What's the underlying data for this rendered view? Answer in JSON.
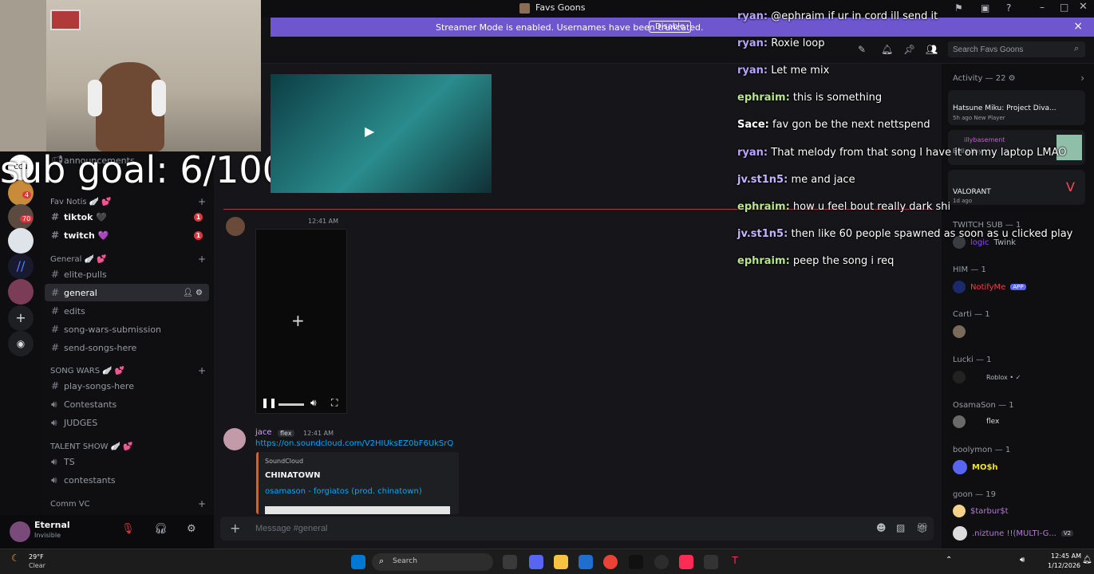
{
  "window": {
    "title": "Favs Goons"
  },
  "banner": {
    "message": "Streamer Mode is enabled. Usernames have been truncated.",
    "disable_label": "Disable",
    "close_icon": "×"
  },
  "stream": {
    "sub_goal": "sub goal: 6/100"
  },
  "toolbar": {
    "search_placeholder": "Search Favs Goons"
  },
  "sidebar": {
    "top_channel": "announcements",
    "categories": [
      {
        "name": "Fav Notis 🪽 💕",
        "channels": [
          {
            "name": "tiktok 🖤",
            "badge": "1"
          },
          {
            "name": "twitch 💜",
            "badge": "1"
          }
        ]
      },
      {
        "name": "General 🪽 💕",
        "channels": [
          {
            "name": "elite-pulls"
          },
          {
            "name": "general"
          },
          {
            "name": "edits"
          },
          {
            "name": "song-wars-submission"
          },
          {
            "name": "send-songs-here"
          }
        ]
      },
      {
        "name": "SONG WARS 🪽 💕",
        "channels": [
          {
            "name": "play-songs-here"
          },
          {
            "name": "Contestants"
          },
          {
            "name": "JUDGES"
          }
        ]
      },
      {
        "name": "TALENT SHOW 🪽 💕",
        "channels": [
          {
            "name": "TS"
          },
          {
            "name": "contestants"
          }
        ]
      },
      {
        "name": "Comm VC"
      }
    ],
    "rail_badges": [
      "4",
      "70"
    ]
  },
  "user": {
    "name": "Eternal",
    "status": "Invisible"
  },
  "messages": {
    "video_time": "12:41 AM",
    "jace": {
      "name": "jace",
      "tag": "flex",
      "time": "12:41 AM",
      "link": "https://on.soundcloud.com/V2HIUksEZ0bF6UkSrQ",
      "embed_provider": "SoundCloud",
      "embed_title": "CHINATOWN",
      "embed_track": "osamason - forgiatos (prod. chinatown)"
    }
  },
  "composer": {
    "placeholder": "Message #general"
  },
  "overlay_chat": [
    {
      "user": "ryan:",
      "text": "@ephraim if ur in cord ill send it",
      "color": "#b9a3ff"
    },
    {
      "user": "ryan:",
      "text": "Roxie loop",
      "color": "#b9a3ff"
    },
    {
      "user": "ryan:",
      "text": "Let me mix",
      "color": "#b9a3ff"
    },
    {
      "user": "ephraim:",
      "text": "this is something",
      "color": "#b7e48d"
    },
    {
      "user": "Sace:",
      "text": "fav gon be the next nettspend",
      "color": "#ffffff"
    },
    {
      "user": "ryan:",
      "text": "That melody from that song I have it on my laptop LMAO",
      "color": "#b9a3ff"
    },
    {
      "user": "jv.st1n5:",
      "text": "me and jace",
      "color": "#c7b4ff"
    },
    {
      "user": "ephraim:",
      "text": "how u feel bout really dark shi",
      "color": "#b7e48d"
    },
    {
      "user": "jv.st1n5:",
      "text": "then like 60 people spawned as soon as u clicked play",
      "color": "#c7b4ff"
    },
    {
      "user": "ephraim:",
      "text": "peep the song i req",
      "color": "#b7e48d"
    }
  ],
  "members": {
    "activity": "Activity — 22 ⚙",
    "activity_cards": [
      {
        "title": "Hatsune Miku: Project Diva...",
        "meta": "5h ago  New Player"
      },
      {
        "title": "illybasement",
        "meta": "Bella Kay"
      },
      {
        "title": "VALORANT",
        "meta": "1d ago"
      }
    ],
    "groups": [
      {
        "header": "TWITCH SUB — 1",
        "rows": [
          {
            "name": "logic",
            "extra": "Twink"
          }
        ]
      },
      {
        "header": "HIM — 1",
        "rows": [
          {
            "name": "NotifyMe",
            "extra": "APP",
            "color": "#f23f43"
          }
        ]
      },
      {
        "header": "Carti — 1",
        "rows": [
          {
            "name": ""
          }
        ]
      },
      {
        "header": "Lucki — 1",
        "rows": [
          {
            "name": "Roblox • ✓",
            "extra": ""
          }
        ]
      },
      {
        "header": "OsamaSon — 1",
        "rows": [
          {
            "name": "flex"
          }
        ]
      },
      {
        "header": "boolymon — 1",
        "rows": [
          {
            "name": "MO$h",
            "color": "#f0e130"
          }
        ]
      },
      {
        "header": "goon — 19",
        "rows": [
          {
            "name": "$tarbur$t",
            "color": "#b27ad9"
          },
          {
            "name": ".niztune !!(MULTI-G...",
            "color": "#b27ad9",
            "extra": "V2"
          }
        ]
      }
    ]
  },
  "taskbar": {
    "weather_temp": "29°F",
    "weather_desc": "Clear",
    "search_placeholder": "Search",
    "time": "12:45 AM",
    "date": "1/12/2026"
  }
}
